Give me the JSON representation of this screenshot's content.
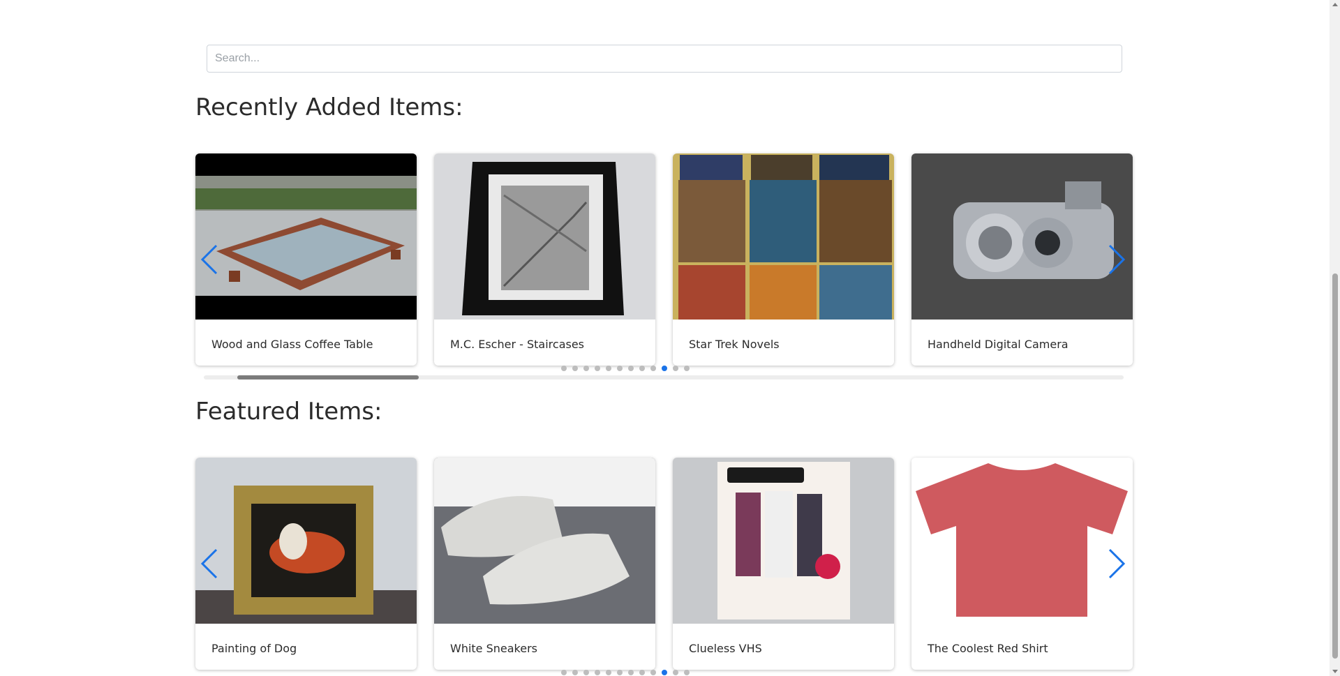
{
  "search": {
    "placeholder": "Search..."
  },
  "recent": {
    "title": "Recently Added Items:",
    "items": [
      {
        "title": "Wood and Glass Coffee Table"
      },
      {
        "title": "M.C. Escher - Staircases"
      },
      {
        "title": "Star Trek Novels"
      },
      {
        "title": "Handheld Digital Camera"
      }
    ],
    "dot_count": 12,
    "active_dot": 9
  },
  "featured": {
    "title": "Featured Items:",
    "items": [
      {
        "title": "Painting of Dog"
      },
      {
        "title": "White Sneakers"
      },
      {
        "title": "Clueless VHS"
      },
      {
        "title": "The Coolest Red Shirt"
      }
    ],
    "dot_count": 12,
    "active_dot": 9
  },
  "icons": {
    "prev": "chevron-left-icon",
    "next": "chevron-right-icon"
  },
  "colors": {
    "accent": "#1a73e8",
    "dot_inactive": "#bdbdbd"
  }
}
